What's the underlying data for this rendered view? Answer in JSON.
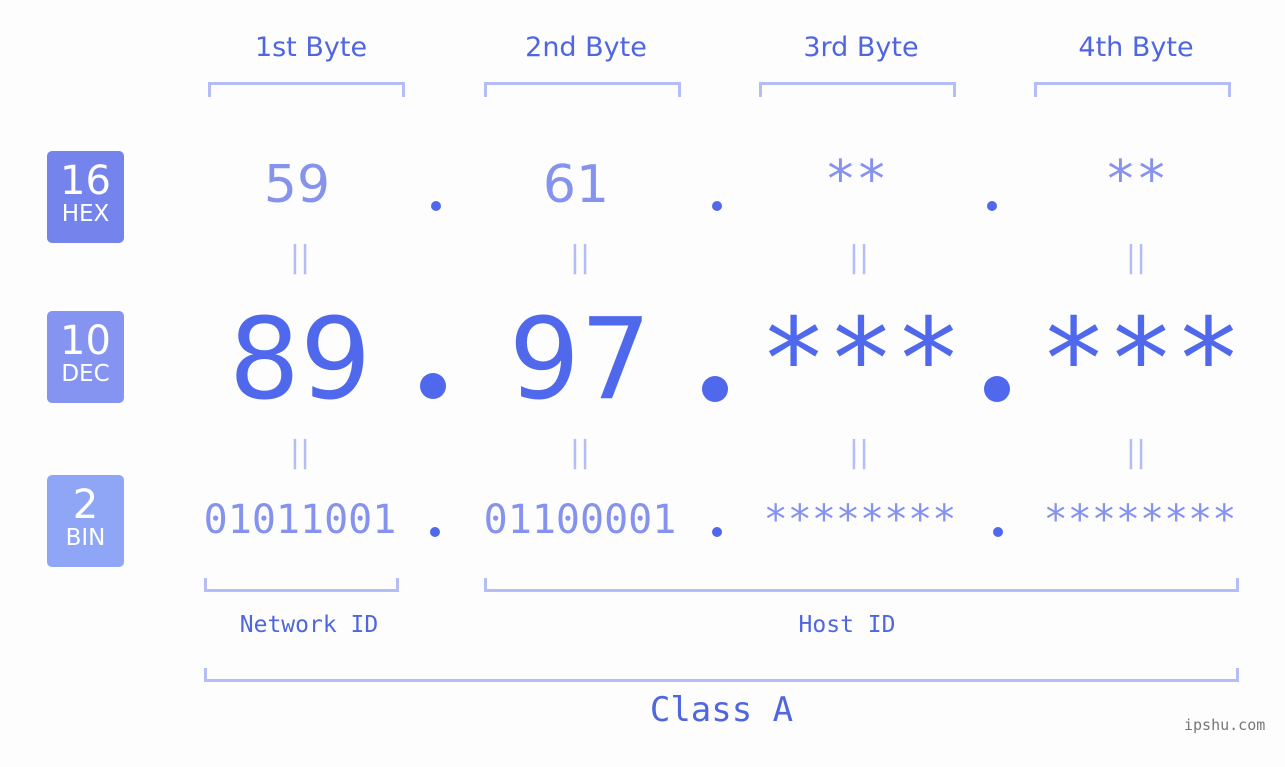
{
  "headers": [
    "1st Byte",
    "2nd Byte",
    "3rd Byte",
    "4th Byte"
  ],
  "rows": {
    "hex": {
      "base": "16",
      "label": "HEX",
      "values": [
        "59",
        "61",
        "**",
        "**"
      ],
      "color": "#7584ec"
    },
    "dec": {
      "base": "10",
      "label": "DEC",
      "values": [
        "89",
        "97",
        "***",
        "***"
      ],
      "color": "#8494f0"
    },
    "bin": {
      "base": "2",
      "label": "BIN",
      "values": [
        "01011001",
        "01100001",
        "********",
        "********"
      ],
      "color": "#8fa6f7"
    }
  },
  "separator": ".",
  "equals": "||",
  "segments": {
    "network": "Network ID",
    "host": "Host ID"
  },
  "class_label": "Class A",
  "watermark": "ipshu.com",
  "colors": {
    "accent": "#5069ec",
    "text_light": "#8592ee",
    "bracket": "#b5bdf7",
    "background": "#fcfdfc"
  }
}
